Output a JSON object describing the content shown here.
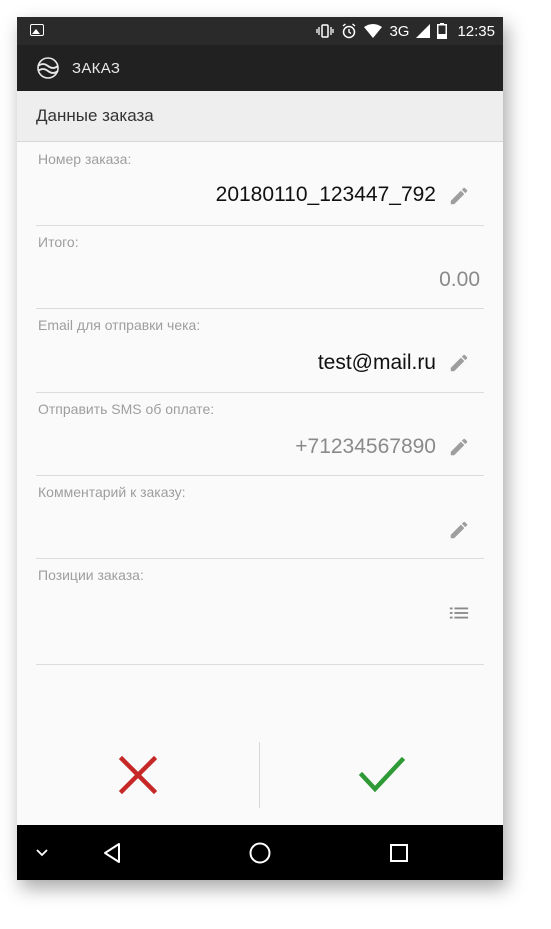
{
  "status_bar": {
    "time": "12:35",
    "network": "3G"
  },
  "toolbar": {
    "title": "ЗАКАЗ"
  },
  "section": {
    "title": "Данные заказа"
  },
  "fields": [
    {
      "label": "Номер заказа:",
      "value": "20180110_123447_792",
      "editable": true
    },
    {
      "label": "Итого:",
      "value": "0.00",
      "editable": false
    },
    {
      "label": "Email для отправки чека:",
      "value": "test@mail.ru",
      "editable": true
    },
    {
      "label": "Отправить SMS об оплате:",
      "value": "+71234567890",
      "editable": true
    },
    {
      "label": "Комментарий к заказу:",
      "value": "",
      "editable": true
    },
    {
      "label": "Позиции заказа:",
      "value": "",
      "editable": false
    }
  ],
  "colors": {
    "cancel": "#c62828",
    "confirm": "#2e9a35",
    "toolbar": "#212121"
  },
  "icons": {
    "edit": "pencil-icon",
    "list": "list-icon",
    "cancel": "close-icon",
    "confirm": "check-icon"
  }
}
